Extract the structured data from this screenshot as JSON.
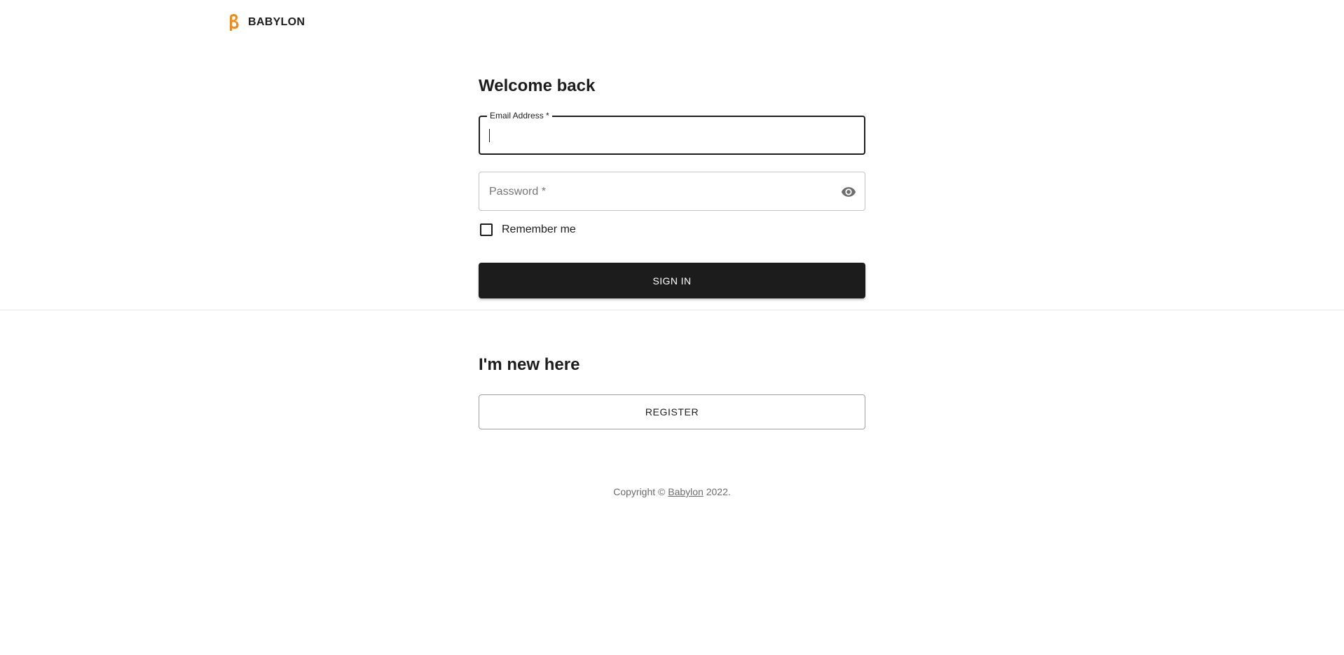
{
  "header": {
    "brand": "BABYLON",
    "logo_icon": "beta-logo-icon",
    "logo_color": "#F08A1C"
  },
  "signin": {
    "title": "Welcome back",
    "email_label": "Email Address *",
    "email_value": "",
    "password_label": "Password *",
    "password_value": "",
    "eye_icon": "visibility-icon",
    "remember_label": "Remember me",
    "remember_checked": false,
    "submit_label": "SIGN IN"
  },
  "register": {
    "title": "I'm new here",
    "button_label": "REGISTER"
  },
  "footer": {
    "prefix": "Copyright © ",
    "link_text": "Babylon",
    "suffix": " 2022."
  },
  "colors": {
    "primary": "#1C1C1C",
    "accent": "#F08A1C",
    "border": "#C4C4C4"
  }
}
